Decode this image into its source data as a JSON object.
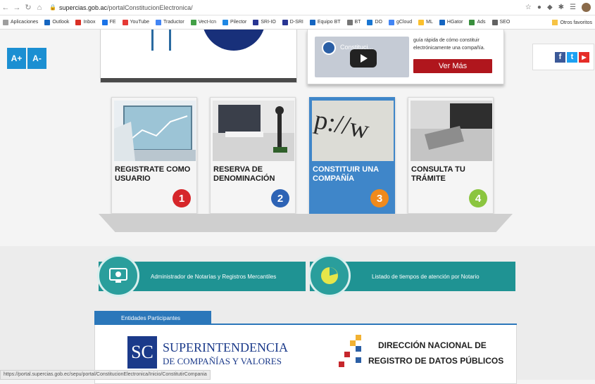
{
  "browser": {
    "url_domain": "supercias.gob.ac",
    "url_path": "/portalConstitucionElectronica/",
    "bookmarks": [
      "Aplicaciones",
      "Outlook",
      "Inbox",
      "FE",
      "YouTube",
      "Traductor",
      "Vect-Icn",
      "Pilector",
      "SRI-IO",
      "D-SRI",
      "Equipo BT",
      "BT",
      "DO",
      "gCloud",
      "ML",
      "HGator",
      "Ads",
      "SEO"
    ],
    "bookmarks_other": "Otros favoritos"
  },
  "font_controls": {
    "increase": "A+",
    "decrease": "A-"
  },
  "video": {
    "title": "Constituci...",
    "description": "guía rápida de cómo constituir electrónicamente una compañía.",
    "button": "Ver Más"
  },
  "social": {
    "facebook": "f",
    "twitter": "t",
    "youtube": "▶"
  },
  "cards": [
    {
      "title": "REGISTRATE COMO USUARIO",
      "number": "1",
      "color": "#d6262a"
    },
    {
      "title": "RESERVA DE DENOMINACIÓN",
      "number": "2",
      "color": "#2d63b5"
    },
    {
      "title": "CONSTITUIR UNA COMPAÑÍA",
      "number": "3",
      "color": "#f08a1c"
    },
    {
      "title": "CONSULTA TU TRÁMITE",
      "number": "4",
      "color": "#8bc53f"
    }
  ],
  "links": {
    "notarias": "Administrador de Notarías y Registros Mercantiles",
    "tiempos": "Listado de tiempos de atención por Notario"
  },
  "entidades": {
    "header": "Entidades Participantes",
    "supercias_line1": "SUPERINTENDENCIA",
    "supercias_line2": "DE COMPAÑÍAS Y VALORES",
    "dinardap_line1": "DIRECCIÓN NACIONAL DE",
    "dinardap_line2": "REGISTRO DE DATOS PÚBLICOS"
  },
  "status_url": "https://portal.supercias.gob.ec/sepu/portal/ConstitucionElectronica/Inicio/ConstitutirCompania"
}
